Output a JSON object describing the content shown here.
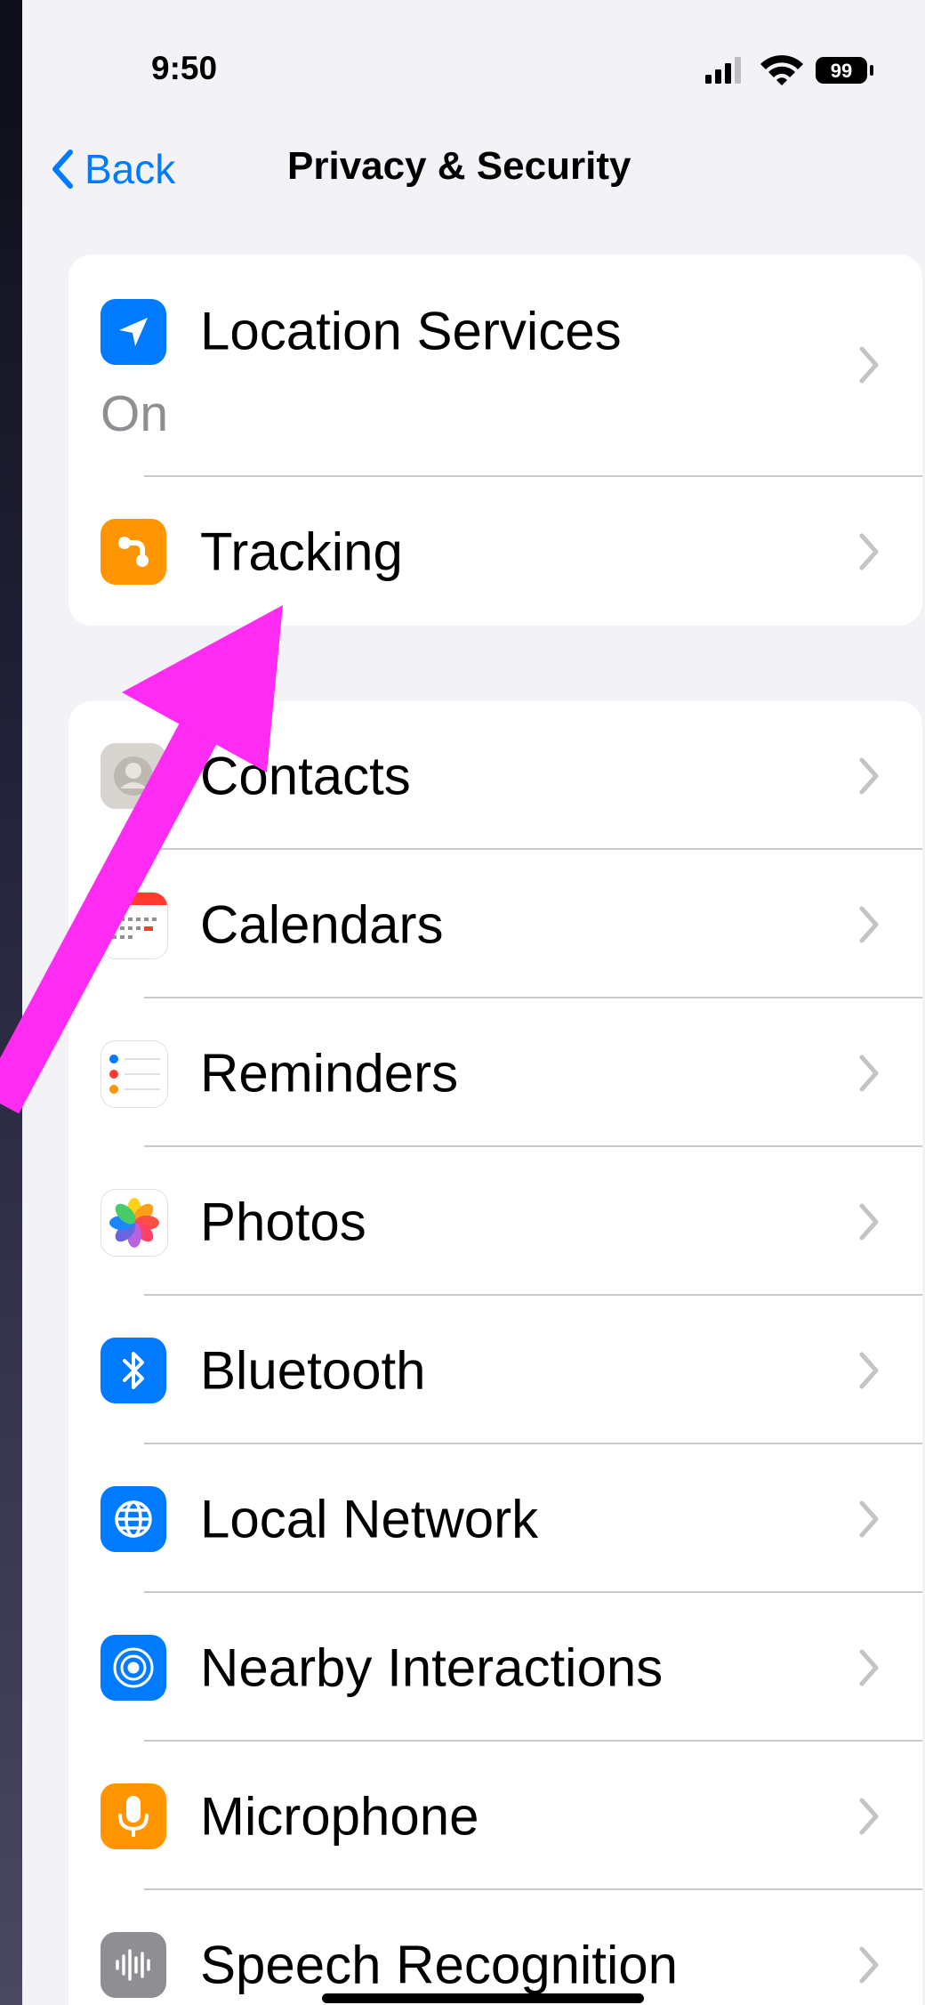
{
  "status_bar": {
    "time": "9:50",
    "battery": "99"
  },
  "nav": {
    "back_label": "Back",
    "title": "Privacy & Security"
  },
  "group1": [
    {
      "label": "Location Services",
      "sublabel": "On",
      "icon": "location-arrow-icon",
      "color": "#007aff"
    },
    {
      "label": "Tracking",
      "icon": "tracking-icon",
      "color": "#ff9500"
    }
  ],
  "group2": [
    {
      "label": "Contacts",
      "icon": "contacts-icon",
      "color": "#d8d4cf"
    },
    {
      "label": "Calendars",
      "icon": "calendar-icon",
      "color": "#ffffff"
    },
    {
      "label": "Reminders",
      "icon": "reminders-icon",
      "color": "#ffffff"
    },
    {
      "label": "Photos",
      "icon": "photos-icon",
      "color": "#ffffff"
    },
    {
      "label": "Bluetooth",
      "icon": "bluetooth-icon",
      "color": "#007aff"
    },
    {
      "label": "Local Network",
      "icon": "globe-icon",
      "color": "#007aff"
    },
    {
      "label": "Nearby Interactions",
      "icon": "nearby-icon",
      "color": "#007aff"
    },
    {
      "label": "Microphone",
      "icon": "microphone-icon",
      "color": "#ff9500"
    },
    {
      "label": "Speech Recognition",
      "icon": "waveform-icon",
      "color": "#8e8e93"
    }
  ],
  "annotation": {
    "arrow_color": "#ff2bf2",
    "points_to": "Tracking"
  }
}
